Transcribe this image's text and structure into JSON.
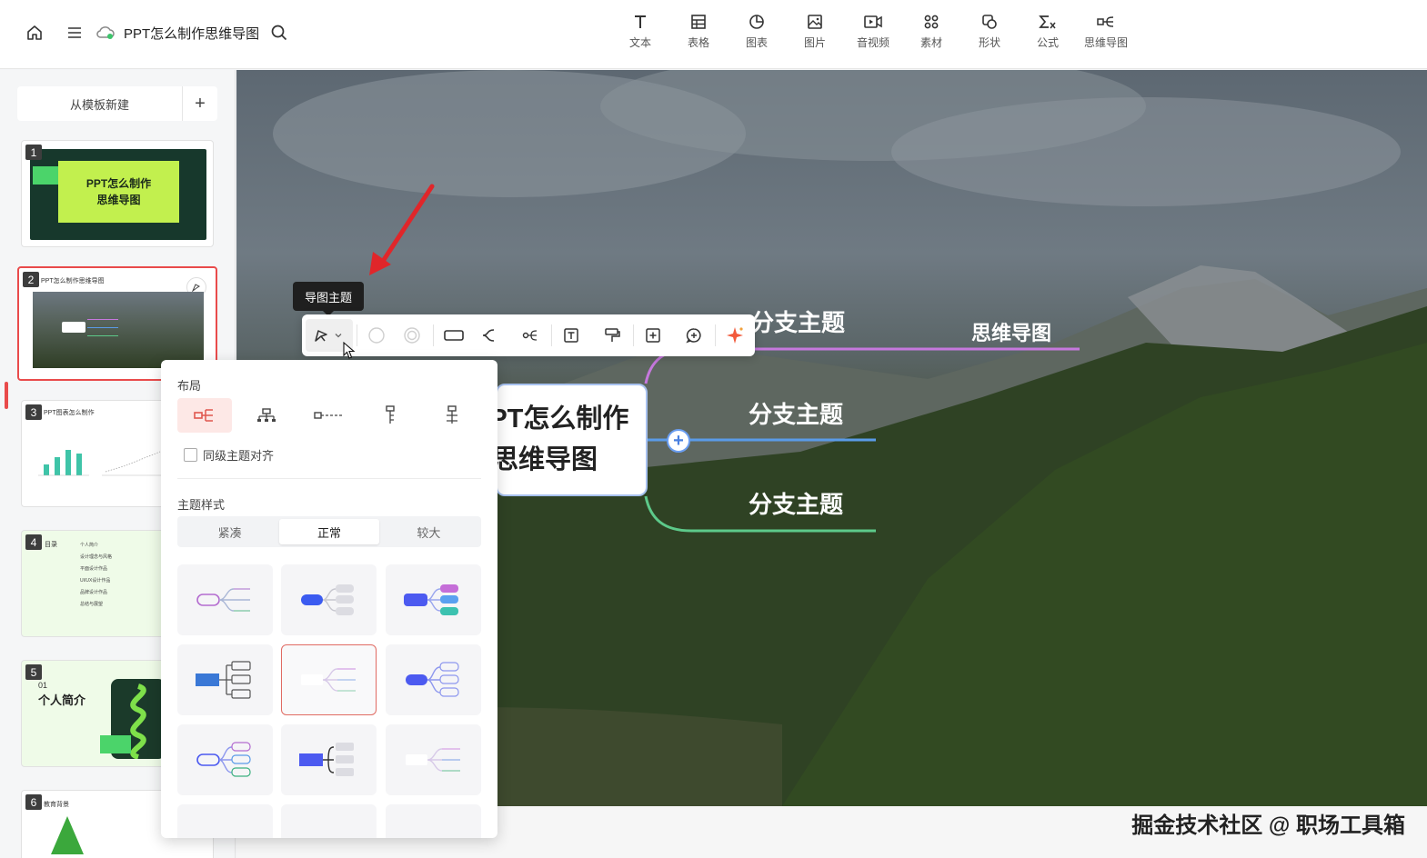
{
  "app": {
    "doc_title": "PPT怎么制作思维导图"
  },
  "toolbar": {
    "items": [
      {
        "label": "文本",
        "icon": "text-icon"
      },
      {
        "label": "表格",
        "icon": "table-icon"
      },
      {
        "label": "图表",
        "icon": "chart-icon"
      },
      {
        "label": "图片",
        "icon": "image-icon"
      },
      {
        "label": "音视频",
        "icon": "video-icon"
      },
      {
        "label": "素材",
        "icon": "assets-icon"
      },
      {
        "label": "形状",
        "icon": "shape-icon"
      },
      {
        "label": "公式",
        "icon": "formula-icon"
      },
      {
        "label": "思维导图",
        "icon": "mindmap-icon"
      }
    ]
  },
  "sidebar": {
    "new_from_template": "从模板新建",
    "add": "+",
    "slides": [
      {
        "num": "1",
        "title_line1": "PPT怎么制作",
        "title_line2": "思维导图"
      },
      {
        "num": "2",
        "title": "PPT怎么制作思维导图"
      },
      {
        "num": "3",
        "title": "PPT图表怎么制作"
      },
      {
        "num": "4",
        "title": "目录",
        "items": [
          "个人简介",
          "设计理念与风格",
          "平面设计作品",
          "UI/UX设计作品",
          "品牌设计作品",
          "总结与展望"
        ]
      },
      {
        "num": "5",
        "sub": "01",
        "title": "个人简介"
      },
      {
        "num": "6",
        "title": "教育背景"
      }
    ]
  },
  "canvas": {
    "center_line1": "PPT怎么制作",
    "center_line2": "思维导图",
    "branches": [
      "分支主题",
      "分支主题",
      "分支主题"
    ],
    "sub_branch": "思维导图",
    "plus": "+"
  },
  "float_toolbar": {
    "tooltip": "导图主题"
  },
  "panel": {
    "layout_title": "布局",
    "align_label": "同级主题对齐",
    "style_title": "主题样式",
    "sizes": [
      "紧凑",
      "正常",
      "较大"
    ],
    "selected_size": "正常"
  },
  "colors": {
    "accent_red": "#e94b4b",
    "branch_purple": "#c678dd",
    "branch_blue": "#5a9be8",
    "branch_green": "#5dc98a",
    "style_blue": "#4c6ef5"
  },
  "watermark": "掘金技术社区 @ 职场工具箱"
}
